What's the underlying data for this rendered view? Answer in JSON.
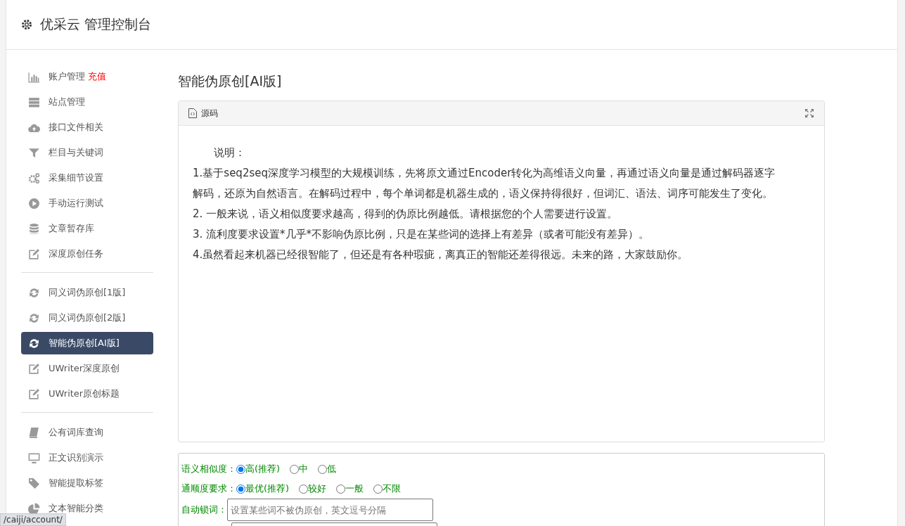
{
  "header": {
    "title": "优采云 管理控制台"
  },
  "sidebar": {
    "groups": [
      {
        "items": [
          {
            "label": "账户管理",
            "badge": "充值",
            "kind": "chart",
            "selected": false
          },
          {
            "label": "站点管理",
            "kind": "server",
            "selected": false
          },
          {
            "label": "接口文件相关",
            "kind": "cloud",
            "selected": false
          },
          {
            "label": "栏目与关键词",
            "kind": "filter",
            "selected": false
          },
          {
            "label": "采集细节设置",
            "kind": "gears",
            "selected": false
          },
          {
            "label": "手动运行测试",
            "kind": "play",
            "selected": false
          },
          {
            "label": "文章暂存库",
            "kind": "database",
            "selected": false
          },
          {
            "label": "深度原创任务",
            "kind": "edit",
            "selected": false
          }
        ]
      },
      {
        "items": [
          {
            "label": "同义词伪原创[1版]",
            "kind": "refresh",
            "selected": false
          },
          {
            "label": "同义词伪原创[2版]",
            "kind": "refresh",
            "selected": false
          },
          {
            "label": "智能伪原创[AI版]",
            "kind": "refresh",
            "selected": true
          },
          {
            "label": "UWriter深度原创",
            "kind": "edit",
            "selected": false
          },
          {
            "label": "UWriter原创标题",
            "kind": "edit",
            "selected": false
          }
        ]
      },
      {
        "items": [
          {
            "label": "公有词库查询",
            "kind": "book",
            "selected": false
          },
          {
            "label": "正文识别演示",
            "kind": "monitor",
            "selected": false
          },
          {
            "label": "智能提取标签",
            "kind": "tag",
            "selected": false
          },
          {
            "label": "文本智能分类",
            "kind": "pie",
            "selected": false
          }
        ]
      }
    ]
  },
  "main": {
    "title": "智能伪原创[AI版]",
    "editor": {
      "toolbar_label": "源码",
      "lines": [
        "　　说明：",
        "1.基于seq2seq深度学习模型的大规模训练，先将原文通过Encoder转化为高维语义向量，再通过语义向量是通过解码器逐字解码，还原为自然语言。在解码过程中，每个单词都是机器生成的，语义保持得很好，但词汇、语法、词序可能发生了变化。",
        "2. 一般来说，语义相似度要求越高，得到的伪原比例越低。请根据您的个人需要进行设置。",
        "3. 流利度要求设置*几乎*不影响伪原比例，只是在某些词的选择上有差异（或者可能没有差异）。",
        "4.虽然看起来机器已经很智能了，但还是有各种瑕疵，离真正的智能还差得很远。未来的路，大家鼓励你。"
      ]
    },
    "settings": [
      {
        "kind": "radio",
        "label": "语义相似度：",
        "options": [
          {
            "label": "高(推荐)",
            "selected": true
          },
          {
            "label": "中",
            "selected": false
          },
          {
            "label": "低",
            "selected": false
          }
        ]
      },
      {
        "kind": "radio",
        "label": "通顺度要求：",
        "options": [
          {
            "label": "最优(推荐)",
            "selected": true
          },
          {
            "label": "较好",
            "selected": false
          },
          {
            "label": "一般",
            "selected": false
          },
          {
            "label": "不限",
            "selected": false
          }
        ]
      },
      {
        "kind": "field",
        "label": "自动锁词：",
        "placeholder": "设置某些词不被伪原创，英文逗号分隔"
      },
      {
        "kind": "field"
      }
    ]
  },
  "status_bar": {
    "url": "/caiji/account/"
  }
}
